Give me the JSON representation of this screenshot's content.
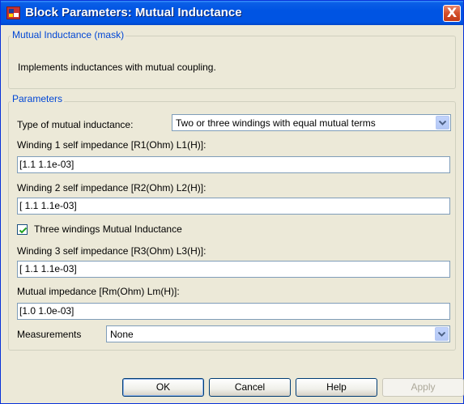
{
  "window": {
    "title": "Block Parameters: Mutual Inductance",
    "close_glyph": "X"
  },
  "mask_group": {
    "legend": "Mutual Inductance (mask)",
    "description": "Implements inductances with mutual coupling."
  },
  "params_group": {
    "legend": "Parameters",
    "type_label": "Type of mutual inductance:",
    "type_value": "Two or three windings with equal mutual terms",
    "w1_label": "Winding 1 self impedance [R1(Ohm) L1(H)]:",
    "w1_value": "[1.1 1.1e-03]",
    "w2_label": "Winding 2 self impedance [R2(Ohm) L2(H)]:",
    "w2_value": "[ 1.1 1.1e-03]",
    "three_label": "Three windings Mutual Inductance",
    "three_checked": true,
    "w3_label": "Winding 3 self impedance [R3(Ohm) L3(H)]:",
    "w3_value": "[ 1.1 1.1e-03]",
    "mutual_label": "Mutual impedance [Rm(Ohm) Lm(H)]:",
    "mutual_value": "[1.0 1.0e-03]",
    "meas_label": "Measurements",
    "meas_value": "None"
  },
  "buttons": {
    "ok": "OK",
    "cancel": "Cancel",
    "help": "Help",
    "apply": "Apply"
  },
  "icons": {
    "title_icon": "simulink-block-icon",
    "dropdown": "chevron-down-icon",
    "check": "checkmark-icon"
  },
  "colors": {
    "titlebar": "#0054e3",
    "legend_text": "#0046d5",
    "dialog_bg": "#ece9d8"
  }
}
